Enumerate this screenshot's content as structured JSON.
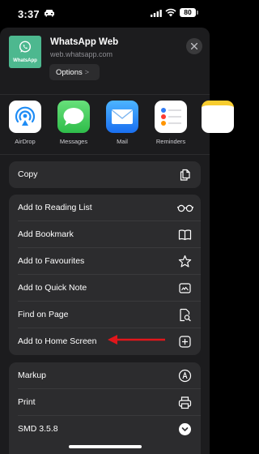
{
  "status_bar": {
    "time": "3:37",
    "battery": "80"
  },
  "app": {
    "title": "WhatsApp Web",
    "url": "web.whatsapp.com",
    "icon_label": "WhatsApp",
    "options_label": "Options",
    "options_chevron": ">"
  },
  "share_targets": [
    {
      "label": "AirDrop",
      "icon": "airdrop-icon"
    },
    {
      "label": "Messages",
      "icon": "messages-icon"
    },
    {
      "label": "Mail",
      "icon": "mail-icon"
    },
    {
      "label": "Reminders",
      "icon": "reminders-icon"
    }
  ],
  "actions_group1": [
    {
      "label": "Copy",
      "icon": "copy-icon"
    }
  ],
  "actions_group2": [
    {
      "label": "Add to Reading List",
      "icon": "glasses-icon"
    },
    {
      "label": "Add Bookmark",
      "icon": "book-icon"
    },
    {
      "label": "Add to Favourites",
      "icon": "star-icon"
    },
    {
      "label": "Add to Quick Note",
      "icon": "quick-note-icon"
    },
    {
      "label": "Find on Page",
      "icon": "find-on-page-icon"
    },
    {
      "label": "Add to Home Screen",
      "icon": "add-square-icon"
    }
  ],
  "actions_group3": [
    {
      "label": "Markup",
      "icon": "markup-icon"
    },
    {
      "label": "Print",
      "icon": "printer-icon"
    },
    {
      "label": "SMD 3.5.8",
      "icon": "chevron-circle-icon"
    }
  ],
  "colors": {
    "sheet_background": "#1c1c1e",
    "group_background": "#2c2c2e",
    "annotation_arrow": "#e0161b",
    "whatsapp_green": "#4db88f"
  }
}
